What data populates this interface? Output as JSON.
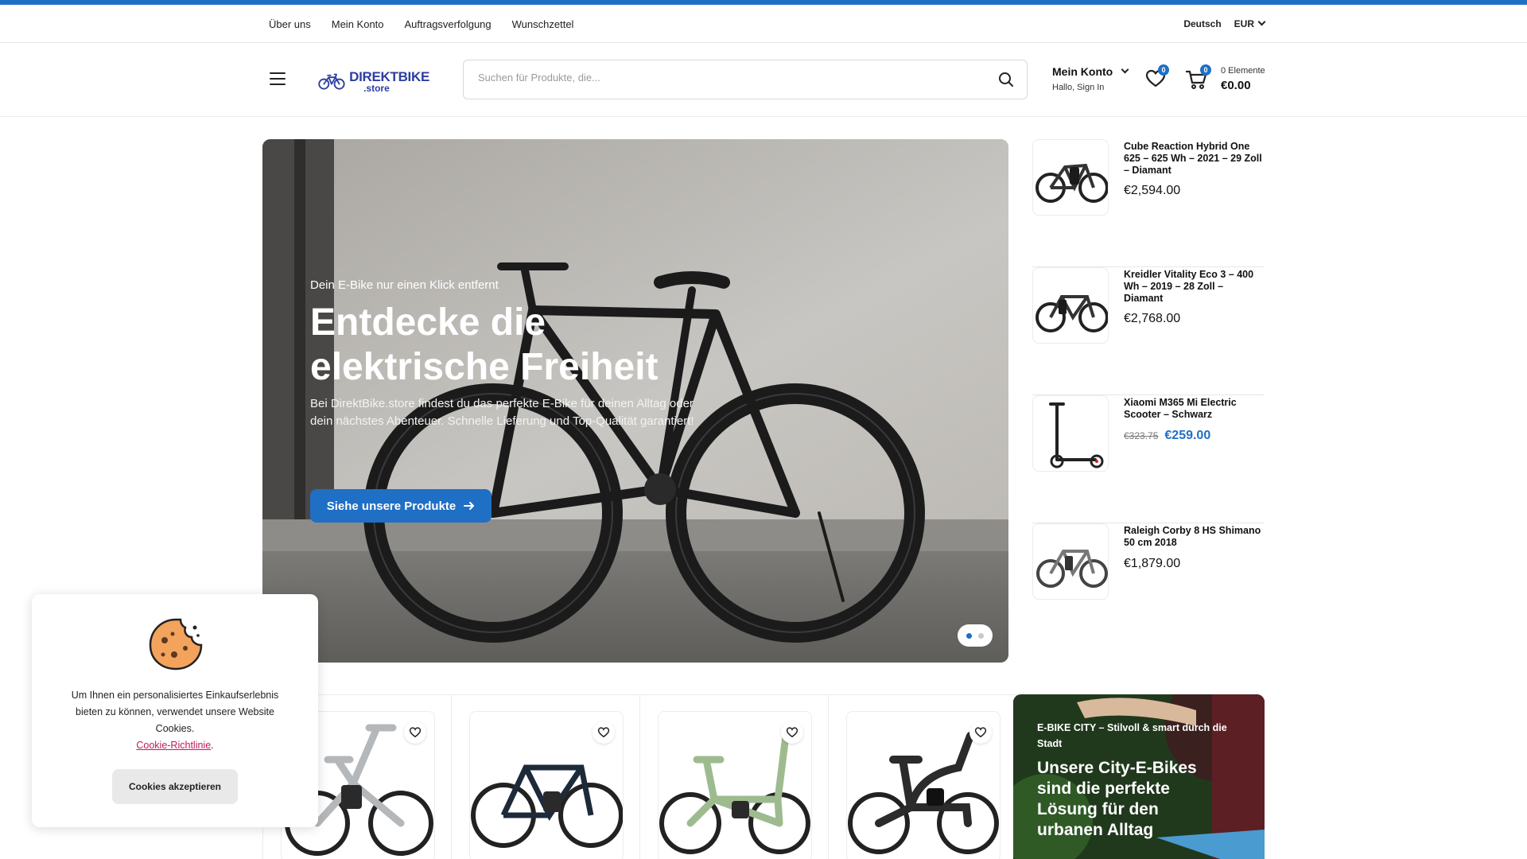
{
  "utility_bar": {
    "links": [
      "Über uns",
      "Mein Konto",
      "Auftragsverfolgung",
      "Wunschzettel"
    ],
    "language": "Deutsch",
    "currency": "EUR"
  },
  "header": {
    "logo_line1": "DIREKTBIKE",
    "logo_line2": ".store",
    "search_placeholder": "Suchen für Produkte, die...",
    "account_title": "Mein Konto",
    "account_sub": "Hallo, Sign In",
    "wishlist_count": "0",
    "cart_count": "0",
    "cart_items": "0 Elemente",
    "cart_total": "€0.00"
  },
  "hero": {
    "kicker": "Dein E-Bike nur einen Klick entfernt",
    "title": "Entdecke die elektrische Freiheit",
    "description": "Bei DirektBike.store findest du das perfekte E-Bike für deinen Alltag oder dein nächstes Abenteuer. Schnelle Lieferung und Top-Qualität garantiert!",
    "cta_label": "Siehe unsere Produkte",
    "slides_total": 2,
    "active_slide": 1
  },
  "side_products": [
    {
      "name": "Cube Reaction Hybrid One 625 – 625 Wh – 2021 – 29 Zoll – Diamant",
      "price": "€2,594.00",
      "old_price": ""
    },
    {
      "name": "Kreidler Vitality Eco 3 – 400 Wh – 2019 – 28 Zoll – Diamant",
      "price": "€2,768.00",
      "old_price": ""
    },
    {
      "name": "Xiaomi M365 Mi Electric Scooter – Schwarz",
      "price": "€259.00",
      "old_price": "€323.75"
    },
    {
      "name": "Raleigh Corby 8 HS Shimano 50 cm 2018",
      "price": "€1,879.00",
      "old_price": ""
    }
  ],
  "promo": {
    "kicker": "E-BIKE CITY – Stilvoll & smart durch die Stadt",
    "title": "Unsere City-E-Bikes sind die perfekte Lösung für den urbanen Alltag"
  },
  "cookie": {
    "text": "Um Ihnen ein personalisiertes Einkaufserlebnis bieten zu können, verwendet unsere Website Cookies.",
    "link_label": "Cookie-Richtlinie",
    "button_label": "Cookies akzeptieren"
  },
  "colors": {
    "accent": "#1f6fc5",
    "logo": "#2c3ea0",
    "link": "#c2185b"
  }
}
